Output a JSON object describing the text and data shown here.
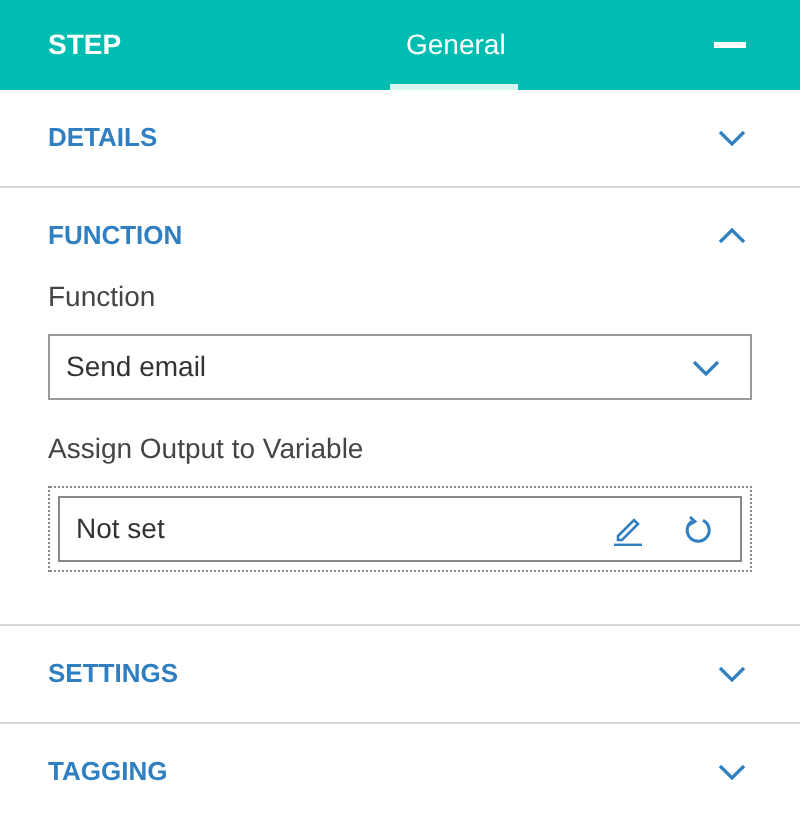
{
  "header": {
    "title": "STEP",
    "tabs": [
      {
        "label": "General",
        "selected": true
      }
    ]
  },
  "sections": [
    {
      "title": "DETAILS",
      "expanded": false
    },
    {
      "title": "FUNCTION",
      "expanded": true,
      "fields": [
        {
          "kind": "select",
          "label": "Function",
          "value": "Send email"
        },
        {
          "kind": "variable",
          "label": "Assign Output to Variable",
          "value": "Not set"
        }
      ]
    },
    {
      "title": "SETTINGS",
      "expanded": false
    },
    {
      "title": "TAGGING",
      "expanded": false
    }
  ]
}
